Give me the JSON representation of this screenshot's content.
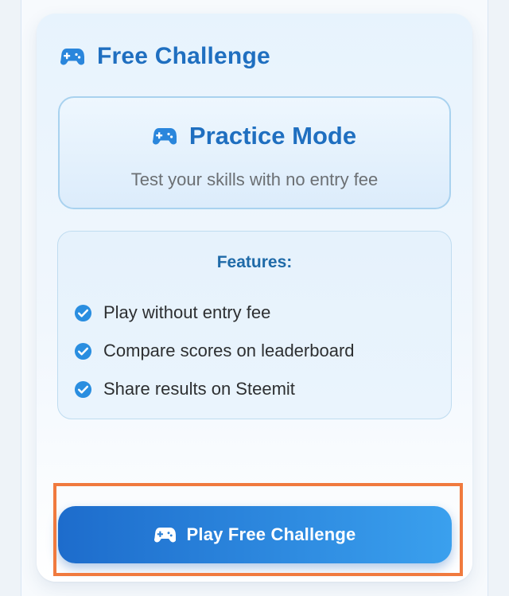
{
  "card": {
    "title": "Free Challenge",
    "icon": "gamepad-icon"
  },
  "mode": {
    "title": "Practice Mode",
    "subtitle": "Test your skills with no entry fee",
    "icon": "gamepad-icon"
  },
  "features": {
    "title": "Features:",
    "items": [
      {
        "label": "Play without entry fee",
        "icon": "check-circle-icon"
      },
      {
        "label": "Compare scores on leaderboard",
        "icon": "check-circle-icon"
      },
      {
        "label": "Share results on Steemit",
        "icon": "check-circle-icon"
      }
    ]
  },
  "action": {
    "label": "Play Free Challenge",
    "icon": "gamepad-icon"
  },
  "colors": {
    "accent": "#1f6fc0",
    "check": "#2a8ee0",
    "highlight": "#f07a3e"
  }
}
